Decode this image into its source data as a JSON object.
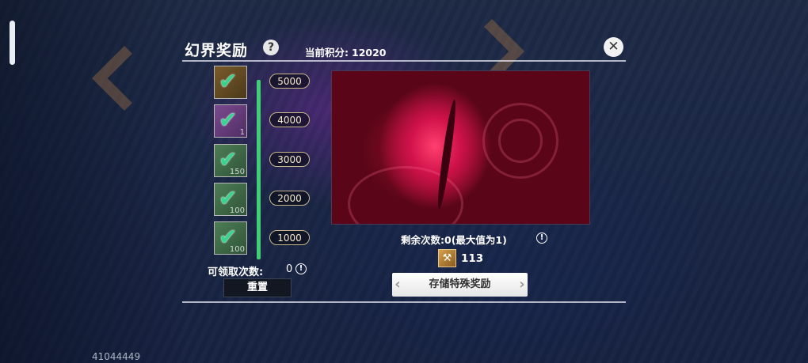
{
  "header": {
    "title": "幻界奖励",
    "help_icon": "?",
    "score_label": "当前积分:",
    "score_value": "12020",
    "close_icon": "✕"
  },
  "progress": {
    "fill_fraction": 1.0
  },
  "tiers": [
    {
      "points": "5000",
      "quantity": "",
      "claimed": true
    },
    {
      "points": "4000",
      "quantity": "1",
      "claimed": true
    },
    {
      "points": "3000",
      "quantity": "150",
      "claimed": true
    },
    {
      "points": "2000",
      "quantity": "100",
      "claimed": true
    },
    {
      "points": "1000",
      "quantity": "100",
      "claimed": true
    }
  ],
  "claim": {
    "label": "可领取次数:",
    "value": "0",
    "info_icon": "!"
  },
  "reset_label": "重置",
  "special": {
    "remaining_text": "剩余次数:0(最大值为1)",
    "info_icon": "!",
    "cost_value": "113",
    "store_label": "存储特殊奖励"
  },
  "footer_id": "41044449",
  "colors": {
    "progress": "#3fcf74",
    "check": "#37d38f"
  }
}
